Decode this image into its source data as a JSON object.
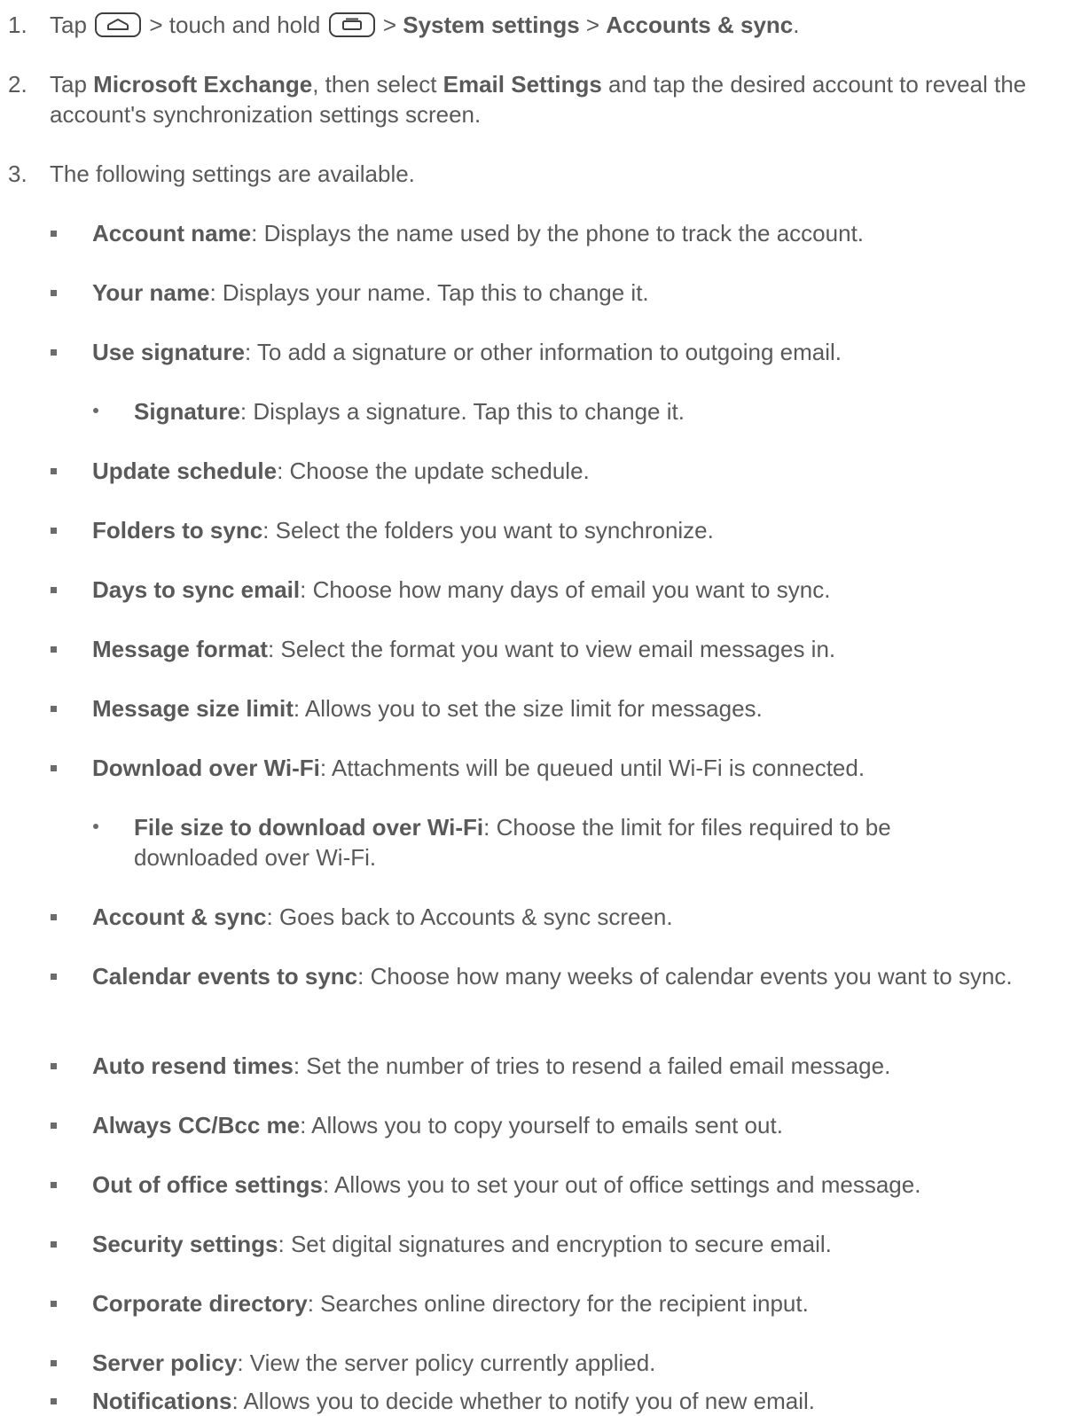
{
  "steps": [
    {
      "num": "1.",
      "t1": "Tap ",
      "icon1": "home-key-icon",
      "t2": " > touch and hold ",
      "icon2": "recent-apps-key-icon",
      "t3": " > ",
      "b1": "System settings",
      "t4": " > ",
      "b2": "Accounts & sync",
      "t5": "."
    },
    {
      "num": "2.",
      "t1": "Tap ",
      "b1": "Microsoft Exchange",
      "t2": ", then select ",
      "b2": "Email Settings",
      "t3": " and tap the desired account to reveal the account's synchronization settings screen."
    },
    {
      "num": "3.",
      "text": "The following settings are available."
    }
  ],
  "settings": [
    {
      "title": "Account name",
      "desc": ": Displays the name used by the phone to track the account."
    },
    {
      "title": "Your name",
      "desc": ": Displays your name. Tap this to change it."
    },
    {
      "title": "Use signature",
      "desc": ": To add a signature or other information to outgoing email."
    },
    {
      "title": "Signature",
      "desc": ": Displays a signature. Tap this to change it."
    },
    {
      "title": "Update schedule",
      "desc": ": Choose the update schedule."
    },
    {
      "title": "Folders to sync",
      "desc": ": Select the folders you want to synchronize."
    },
    {
      "title": "Days to sync email",
      "desc": ": Choose how many days of email you want to sync."
    },
    {
      "title": "Message format",
      "desc": ": Select the format you want to view email messages in."
    },
    {
      "title": "Message size limit",
      "desc": ": Allows you to set the size limit for messages."
    },
    {
      "title": "Download over Wi-Fi",
      "desc": ": Attachments will be queued until Wi-Fi is connected."
    },
    {
      "title": "File size to download over Wi-Fi",
      "desc": ": Choose the limit for files required to be downloaded over Wi-Fi."
    },
    {
      "title": "Account & sync",
      "desc": ": Goes back to Accounts & sync screen."
    },
    {
      "title": "Calendar events to sync",
      "desc": ": Choose how many weeks of calendar events you want to sync."
    },
    {
      "title": "Auto resend times",
      "desc": ": Set the number of tries to resend a failed email message."
    },
    {
      "title": "Always CC/Bcc me",
      "desc": ": Allows you to copy yourself to emails sent out."
    },
    {
      "title": "Out of office settings",
      "desc": ": Allows you to set your out of office settings and message."
    },
    {
      "title": "Security settings",
      "desc": ": Set digital signatures and encryption to secure email."
    },
    {
      "title": "Corporate directory",
      "desc": ": Searches online directory for the recipient input."
    },
    {
      "title": "Server policy",
      "desc": ": View the server policy currently applied."
    },
    {
      "title": "Notifications",
      "desc": ": Allows you to decide whether to notify you of new email."
    }
  ]
}
